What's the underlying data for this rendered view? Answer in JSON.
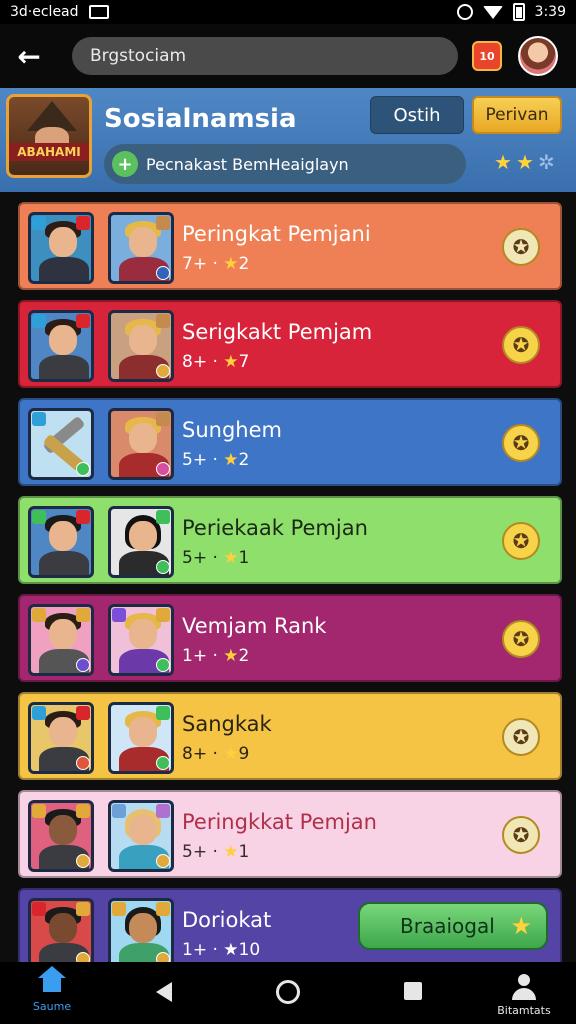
{
  "status_bar": {
    "left_text": "3d·eclead",
    "time": "3:39"
  },
  "top_bar": {
    "search_text": "Brgstociam",
    "calendar_label": "10"
  },
  "header": {
    "logo_text": "ABAHAMI",
    "title": "Sosialnamsia",
    "btn_ostih": "Ostih",
    "btn_perivan": "Perivan",
    "subtitle": "Pecnakast BemHeaiglayn",
    "plus_icon": "+"
  },
  "rows": [
    {
      "name": "Peringkat Pemjani",
      "stats_left": "7+ ·",
      "stars": "2",
      "bg": "#ef7f55"
    },
    {
      "name": "Serigkakt Pemjam",
      "stats_left": "8+ ·",
      "stars": "7",
      "bg": "#d7243a"
    },
    {
      "name": "Sunghem",
      "stats_left": "5+ ·",
      "stars": "2",
      "bg": "#3f75c7"
    },
    {
      "name": "Periekaak Pemjan",
      "stats_left": "5+ ·",
      "stars": "1",
      "bg": "#8fdf6c"
    },
    {
      "name": "Vemjam Rank",
      "stats_left": "1+ ·",
      "stars": "2",
      "bg": "#a3276e"
    },
    {
      "name": "Sangkak",
      "stats_left": "8+ ·",
      "stars": "9",
      "bg": "#f5c445"
    },
    {
      "name": "Peringkkat Pemjan",
      "stats_left": "5+ ·",
      "stars": "1",
      "bg": "#f8d3e6"
    },
    {
      "name": "Doriokat",
      "stats_left": "1+ ·",
      "stars": "10",
      "bg": "#5444a6"
    }
  ],
  "share_button_label": "Braaiogal",
  "bottom_nav": {
    "home_label": "Saume",
    "profile_label": "Bitamtats"
  },
  "colors": {
    "header_blue": "#4a82c0",
    "yellow": "#f5c445",
    "green": "#4fbf5a"
  }
}
